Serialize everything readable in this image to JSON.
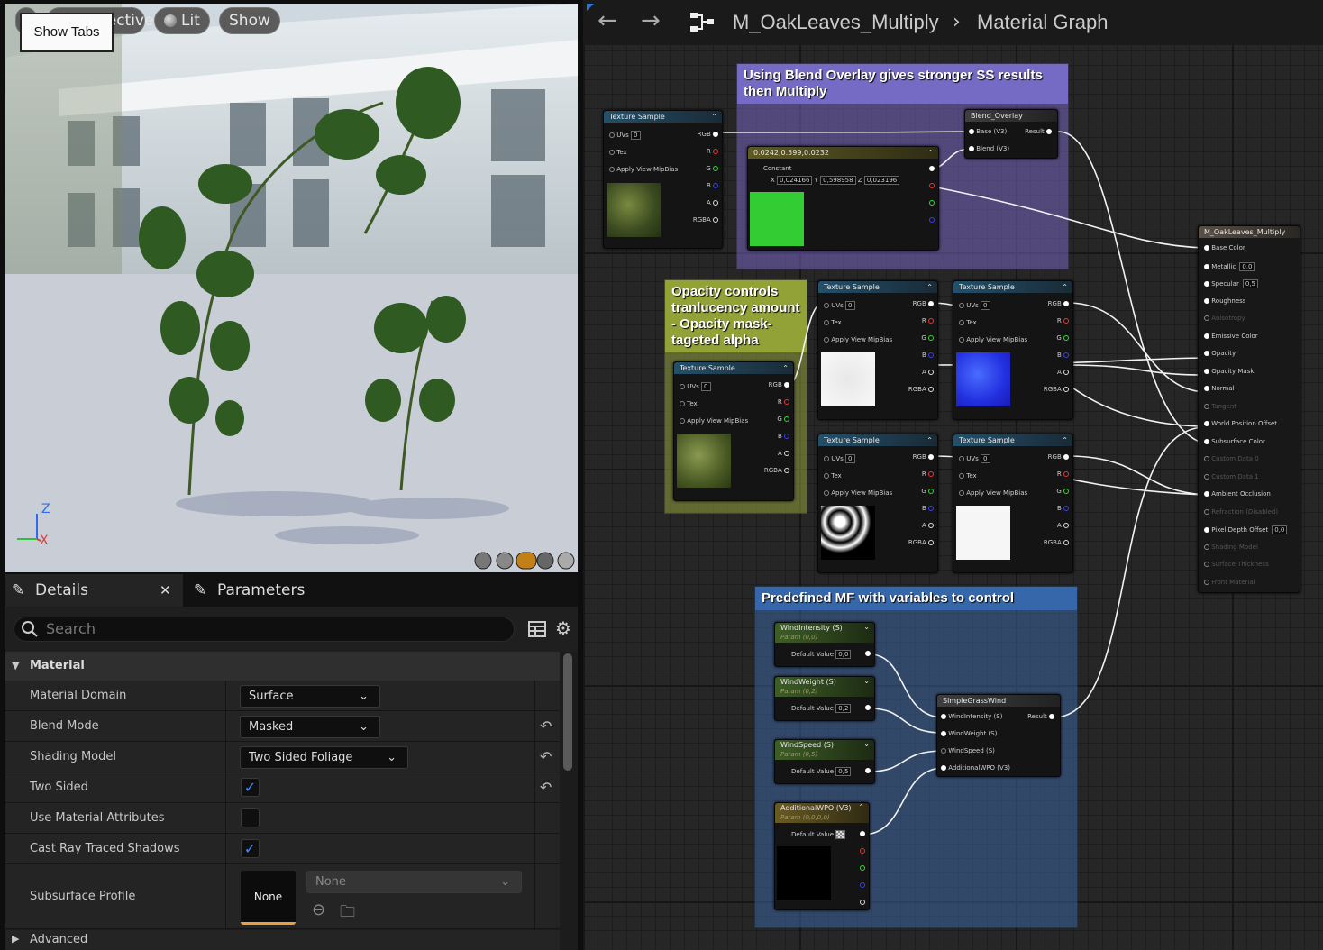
{
  "viewport": {
    "buttons": {
      "perspective": "Perspective",
      "lit": "Lit",
      "show": "Show"
    },
    "tooltip": "Show Tabs",
    "axes": {
      "z": "Z",
      "x": "X"
    }
  },
  "panel": {
    "tabs": {
      "details": "Details",
      "parameters": "Parameters"
    },
    "search_placeholder": "Search",
    "section": "Material",
    "rows": {
      "material_domain": {
        "label": "Material Domain",
        "value": "Surface"
      },
      "blend_mode": {
        "label": "Blend Mode",
        "value": "Masked"
      },
      "shading_model": {
        "label": "Shading Model",
        "value": "Two Sided Foliage"
      },
      "two_sided": {
        "label": "Two Sided",
        "checked": true
      },
      "use_material_attributes": {
        "label": "Use Material Attributes",
        "checked": false
      },
      "cast_ray_traced_shadows": {
        "label": "Cast Ray Traced Shadows",
        "checked": true
      },
      "subsurface_profile": {
        "label": "Subsurface Profile",
        "thumb": "None",
        "value": "None"
      }
    },
    "advanced": "Advanced"
  },
  "graph": {
    "breadcrumb": {
      "asset": "M_OakLeaves_Multiply",
      "graph": "Material Graph"
    },
    "comments": {
      "blend": "Using Blend Overlay gives stronger SS results then Multiply",
      "opacity": "Opacity controls tranlucency amount - Opacity mask- tageted alpha",
      "mf": "Predefined MF with variables to control"
    },
    "texture_sample": {
      "title": "Texture Sample",
      "uvs": "UVs",
      "uvs_val": "0",
      "tex": "Tex",
      "mip": "Apply View MipBias",
      "rgb": "RGB",
      "r": "R",
      "g": "G",
      "b": "B",
      "a": "A",
      "rgba": "RGBA"
    },
    "blend_overlay": {
      "title": "Blend_Overlay",
      "base": "Base (V3)",
      "blend": "Blend (V3)",
      "result": "Result"
    },
    "constant": {
      "title": "0.0242,0.599,0.0232",
      "label": "Constant",
      "x": "0,024166",
      "y": "0,598958",
      "z": "0,023196",
      "color": "#33cc33"
    },
    "material": {
      "title": "M_OakLeaves_Multiply",
      "pins": [
        {
          "name": "Base Color",
          "on": true
        },
        {
          "name": "Metallic",
          "on": true,
          "val": "0,0"
        },
        {
          "name": "Specular",
          "on": true,
          "val": "0,5"
        },
        {
          "name": "Roughness",
          "on": true
        },
        {
          "name": "Anisotropy",
          "on": false
        },
        {
          "name": "Emissive Color",
          "on": true
        },
        {
          "name": "Opacity",
          "on": true
        },
        {
          "name": "Opacity Mask",
          "on": true
        },
        {
          "name": "Normal",
          "on": true
        },
        {
          "name": "Tangent",
          "on": false
        },
        {
          "name": "World Position Offset",
          "on": true
        },
        {
          "name": "Subsurface Color",
          "on": true
        },
        {
          "name": "Custom Data 0",
          "on": false
        },
        {
          "name": "Custom Data 1",
          "on": false
        },
        {
          "name": "Ambient Occlusion",
          "on": true
        },
        {
          "name": "Refraction (Disabled)",
          "on": false
        },
        {
          "name": "Pixel Depth Offset",
          "on": true,
          "val": "0,0"
        },
        {
          "name": "Shading Model",
          "on": false
        },
        {
          "name": "Surface Thickness",
          "on": false
        },
        {
          "name": "Front Material",
          "on": false
        }
      ]
    },
    "params": {
      "wind_intensity": {
        "title": "WindIntensity (S)",
        "sub": "Param (0,0)",
        "default": "Default Value",
        "val": "0,0"
      },
      "wind_weight": {
        "title": "WindWeight (S)",
        "sub": "Param (0,2)",
        "default": "Default Value",
        "val": "0,2"
      },
      "wind_speed": {
        "title": "WindSpeed (S)",
        "sub": "Param (0,5)",
        "default": "Default Value",
        "val": "0,5"
      },
      "additional_wpo": {
        "title": "AdditionalWPO (V3)",
        "sub": "Param (0,0,0,0)",
        "default": "Default Value"
      }
    },
    "simple_grass_wind": {
      "title": "SimpleGrassWind",
      "pins": [
        "WindIntensity (S)",
        "WindWeight (S)",
        "WindSpeed (S)",
        "AdditionalWPO (V3)"
      ],
      "result": "Result"
    }
  }
}
